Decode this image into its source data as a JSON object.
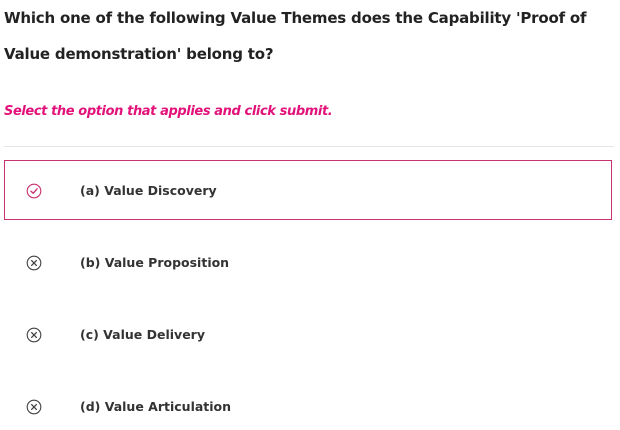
{
  "question": {
    "text": "Which one of the following Value Themes does the Capability 'Proof of Value demonstration' belong to?"
  },
  "instruction": "Select the option that applies and click submit.",
  "colors": {
    "accent": "#e2127a",
    "selected_border": "#c9316f",
    "icon_gray": "#444444"
  },
  "options": [
    {
      "label": "(a) Value Discovery",
      "icon": "check-circle-icon",
      "selected": true
    },
    {
      "label": "(b) Value Proposition",
      "icon": "x-circle-icon",
      "selected": false
    },
    {
      "label": "(c) Value Delivery",
      "icon": "x-circle-icon",
      "selected": false
    },
    {
      "label": "(d) Value Articulation",
      "icon": "x-circle-icon",
      "selected": false
    }
  ]
}
